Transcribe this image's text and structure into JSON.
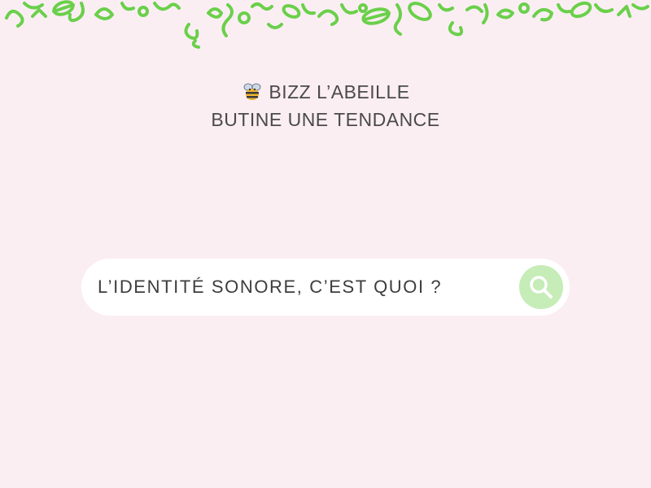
{
  "header": {
    "line1": "BIZZ L’ABEILLE",
    "line2": "BUTINE UNE TENDANCE",
    "icon": "bee-icon"
  },
  "search": {
    "query": "L’IDENTITÉ SONORE, C’EST QUOI ?",
    "button_icon": "search-icon"
  },
  "colors": {
    "background": "#fbeef3",
    "doodle": "#6ad04a",
    "search_button": "#c6ecb7",
    "text": "#4a4a4a"
  }
}
